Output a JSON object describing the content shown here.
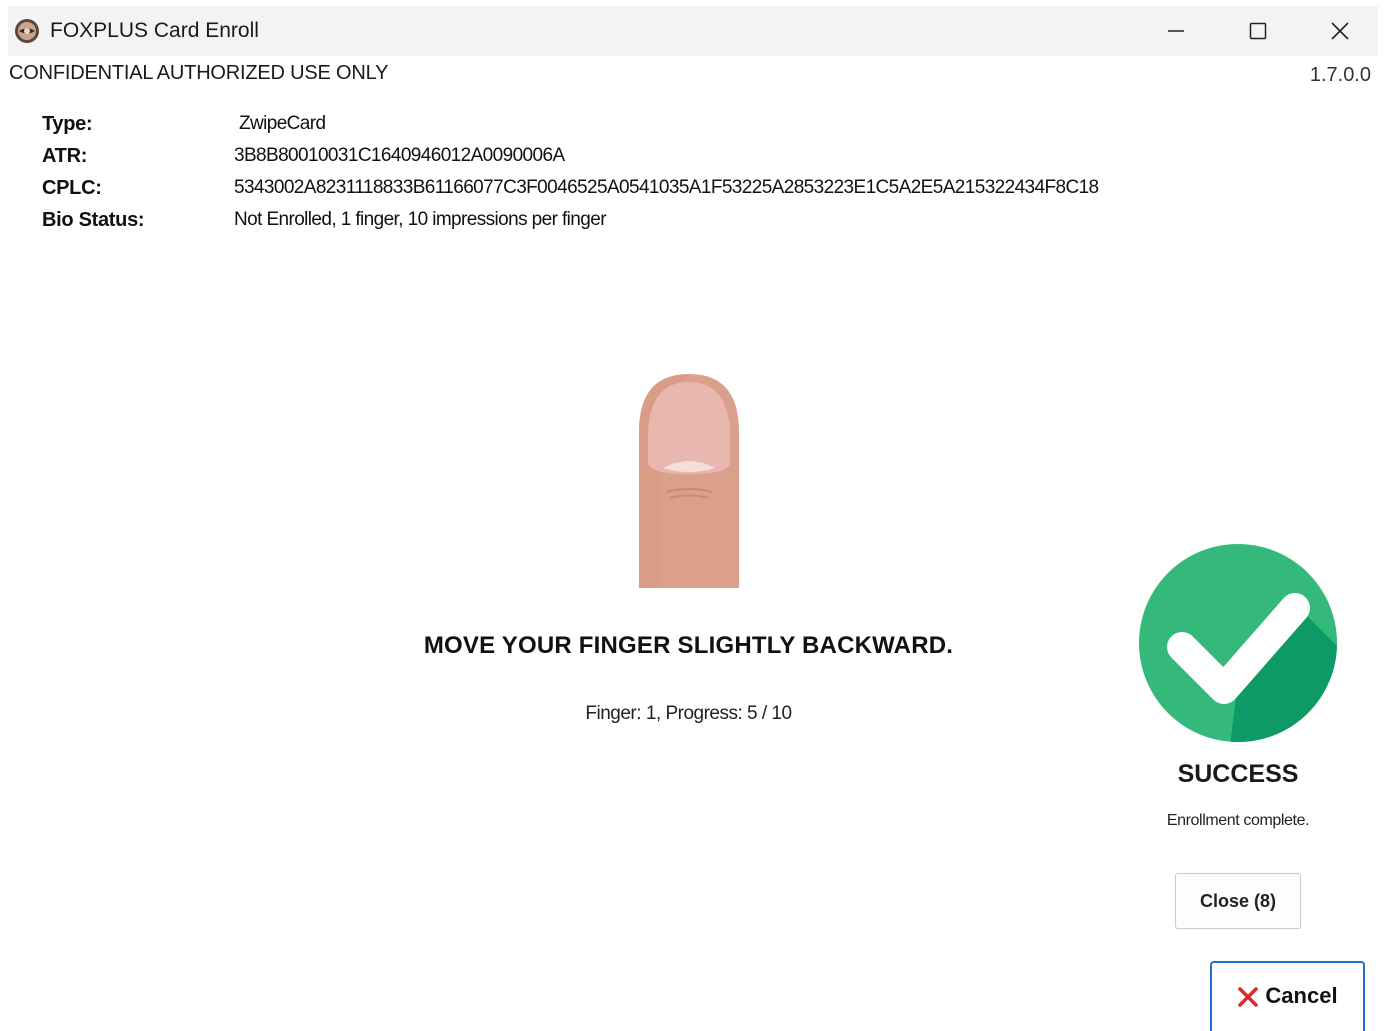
{
  "window": {
    "title": "FOXPLUS Card Enroll"
  },
  "header": {
    "confidential": "CONFIDENTIAL AUTHORIZED USE ONLY",
    "version": "1.7.0.0"
  },
  "card_info": [
    {
      "label": "Type:",
      "value": "ZwipeCard"
    },
    {
      "label": "ATR:",
      "value": "3B8B80010031C1640946012A0090006A"
    },
    {
      "label": "CPLC:",
      "value": "5343002A8231118833B61166077C3F0046525A0541035A1F53225A2853223E1C5A2E5A215322434F8C18"
    },
    {
      "label": "Bio Status:",
      "value": "Not Enrolled, 1 finger, 10 impressions per finger"
    }
  ],
  "enrollment": {
    "instruction": "MOVE YOUR FINGER SLIGHTLY BACKWARD.",
    "progress": "Finger: 1, Progress: 5 / 10"
  },
  "result": {
    "title": "SUCCESS",
    "message": "Enrollment complete."
  },
  "buttons": {
    "close_label": "Close (8)",
    "cancel_label": "Cancel"
  },
  "colors": {
    "success_green": "#35b97a",
    "success_shadow": "#0e9a66",
    "finger_skin": "#dba08c",
    "finger_nail": "#e8b7b0",
    "cancel_red": "#d92b2b",
    "focus_blue": "#1e6fd0"
  },
  "icons": {
    "app": "fox-seal-icon",
    "success": "checkmark-circle-icon",
    "finger": "finger-icon",
    "cancel": "x-icon"
  }
}
